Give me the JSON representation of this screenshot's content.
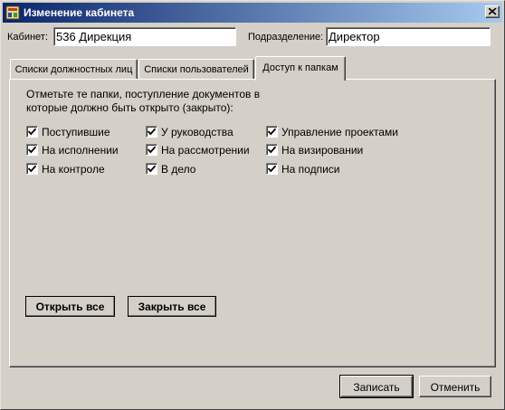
{
  "window": {
    "title": "Изменение кабинета",
    "icon": "cabinet-app-icon"
  },
  "header": {
    "cabinet_label": "Кабинет:",
    "cabinet_value": "536 Дирекция",
    "division_label": "Подразделение:",
    "division_value": "Директор"
  },
  "tabs": [
    {
      "label": "Списки должностных лиц",
      "active": false
    },
    {
      "label": "Списки пользователей",
      "active": false
    },
    {
      "label": "Доступ к папкам",
      "active": true
    }
  ],
  "panel": {
    "instructions": "Отметьте те папки, поступление документов в которые должно быть открыто (закрыто):",
    "folders": [
      {
        "label": "Поступившие",
        "checked": true
      },
      {
        "label": "На исполнении",
        "checked": true
      },
      {
        "label": "На контроле",
        "checked": true
      },
      {
        "label": "У руководства",
        "checked": true
      },
      {
        "label": "На рассмотрении",
        "checked": true
      },
      {
        "label": "В дело",
        "checked": true
      },
      {
        "label": "Управление проектами",
        "checked": true
      },
      {
        "label": "На визировании",
        "checked": true
      },
      {
        "label": "На подписи",
        "checked": true
      }
    ],
    "open_all_label": "Открыть все",
    "close_all_label": "Закрыть все"
  },
  "footer": {
    "save_label": "Записать",
    "cancel_label": "Отменить"
  }
}
